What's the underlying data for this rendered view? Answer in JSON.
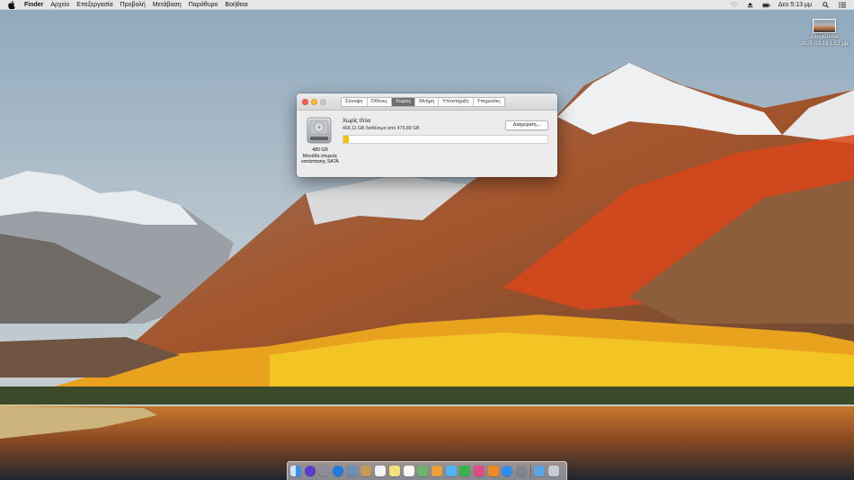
{
  "menubar": {
    "app_name": "Finder",
    "items": [
      "Αρχείο",
      "Επεξεργασία",
      "Προβολή",
      "Μετάβαση",
      "Παράθυρο",
      "Βοήθεια"
    ],
    "clock": "Δευ 5:13 μμ"
  },
  "desktop_file": {
    "name": "Στιγμιότυπο",
    "date": "2025-03-19 1:57 μμ"
  },
  "about_window": {
    "tabs": [
      {
        "label": "Σύνοψη",
        "active": false
      },
      {
        "label": "Οθόνες",
        "active": false
      },
      {
        "label": "Χώρος",
        "active": true
      },
      {
        "label": "Μνήμη",
        "active": false
      },
      {
        "label": "Υποστήριξη",
        "active": false
      },
      {
        "label": "Υπηρεσίες",
        "active": false
      }
    ],
    "storage": {
      "disk_size": "480 GB",
      "disk_type_line1": "Μονάδα στερεάς",
      "disk_type_line2": "κατάστασης SATA",
      "volume_name": "Χωρίς τίτλο",
      "free_text": "468,11 GB διαθέσιμα από 479,89 GB",
      "used_fraction": 0.025,
      "manage_label": "Διαχείριση...",
      "used_color": "#f5c000"
    }
  },
  "dock": {
    "items": [
      {
        "name": "finder-icon",
        "color": "#3d8ff0"
      },
      {
        "name": "siri-icon",
        "color": "#5a3ec8"
      },
      {
        "name": "launchpad-icon",
        "color": "#8a8f99"
      },
      {
        "name": "safari-icon",
        "color": "#1f7ae0"
      },
      {
        "name": "mail-icon",
        "color": "#6d8fb5"
      },
      {
        "name": "contacts-icon",
        "color": "#c79a57"
      },
      {
        "name": "calendar-icon",
        "color": "#f2f2f2"
      },
      {
        "name": "notes-icon",
        "color": "#f4e27a"
      },
      {
        "name": "reminders-icon",
        "color": "#f7f7f7"
      },
      {
        "name": "maps-icon",
        "color": "#6fb36f"
      },
      {
        "name": "photos-icon",
        "color": "#e8a33a"
      },
      {
        "name": "messages-icon",
        "color": "#4fb3f5"
      },
      {
        "name": "facetime-icon",
        "color": "#38b24d"
      },
      {
        "name": "itunes-icon",
        "color": "#e34b84"
      },
      {
        "name": "ibooks-icon",
        "color": "#f08a24"
      },
      {
        "name": "app-store-icon",
        "color": "#2f8df2"
      },
      {
        "name": "system-preferences-icon",
        "color": "#7f858f"
      },
      {
        "name": "downloads-folder-icon",
        "color": "#57a7e8"
      },
      {
        "name": "trash-icon",
        "color": "#c9cdd3"
      }
    ]
  }
}
